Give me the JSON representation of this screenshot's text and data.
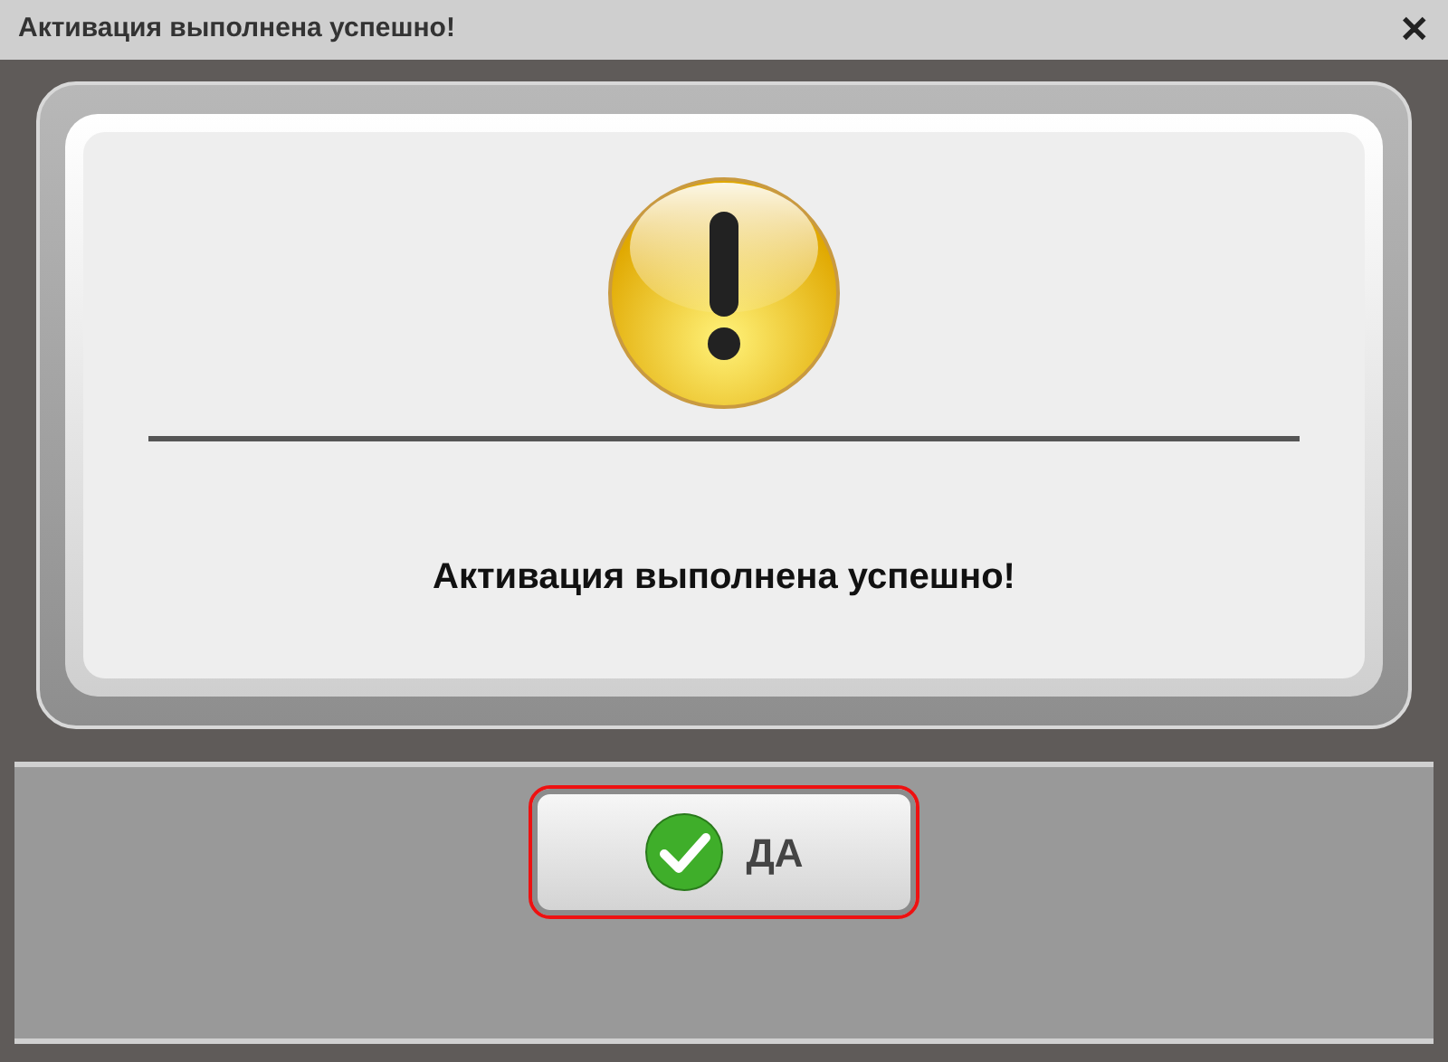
{
  "window": {
    "title": "Активация выполнена успешно!",
    "close": "✕"
  },
  "message": "Активация выполнена успешно!",
  "button": {
    "label": "ДА",
    "focused": true
  }
}
